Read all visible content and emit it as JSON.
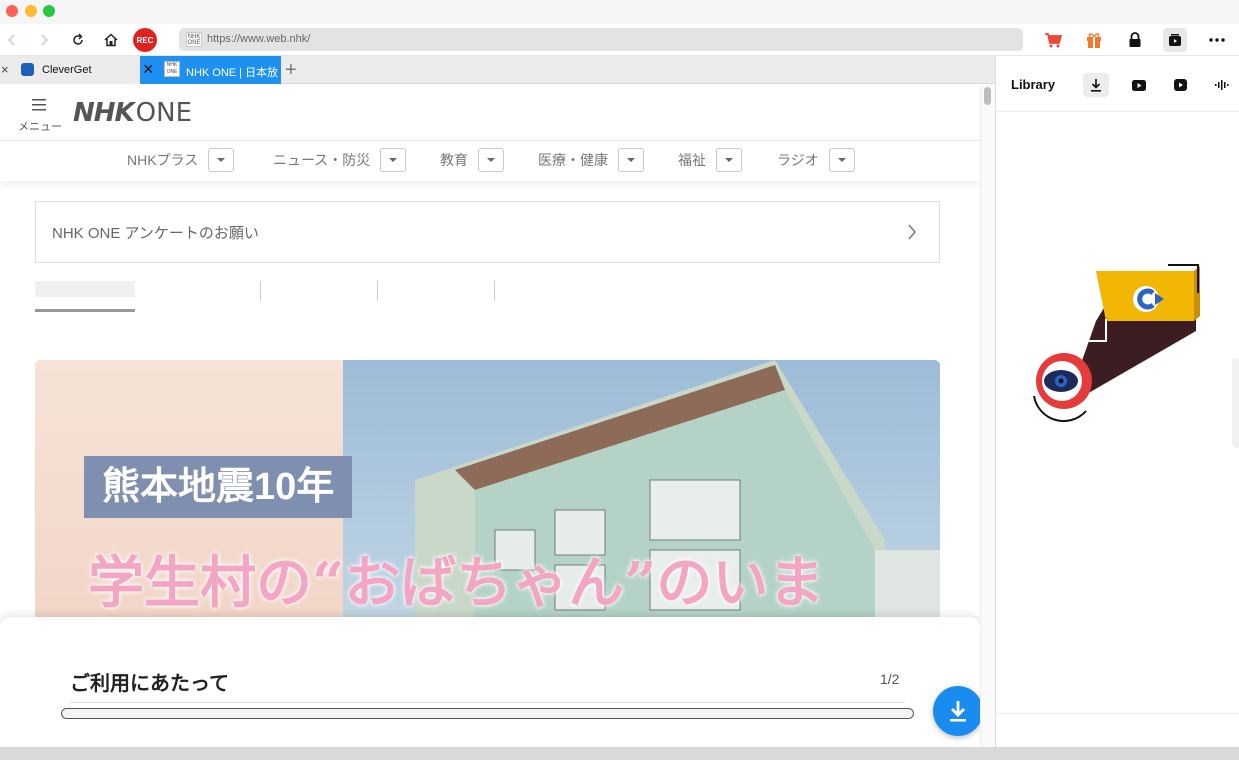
{
  "browser": {
    "url": "https://www.web.nhk/",
    "favicon_text": "NHK ONE",
    "rec_label": "REC",
    "tabs": [
      {
        "label": "CleverGet",
        "active": false
      },
      {
        "label": "NHK ONE | 日本放",
        "active": true
      }
    ]
  },
  "nhk": {
    "menu_label": "メニュー",
    "logo_text": "NHK ONE",
    "nav": [
      "NHKプラス",
      "ニュース・防災",
      "教育",
      "医療・健康",
      "福祉",
      "ラジオ"
    ],
    "survey_text": "NHK ONE アンケートのお願い",
    "banner_title_box": "熊本地震10年",
    "banner_title_main": "学生村の“おばちゃん”のいま",
    "bottom_sheet": {
      "title": "ご利用にあたって",
      "pager": "1/2",
      "progress_fraction": 0.5
    }
  },
  "library": {
    "title": "Library"
  },
  "colors": {
    "accent_blue": "#1a8cf0",
    "rec_red": "#e0231c",
    "tab_active": "#1e90f0",
    "cart_red": "#e84a3a",
    "gift_orange": "#f07a2a"
  }
}
